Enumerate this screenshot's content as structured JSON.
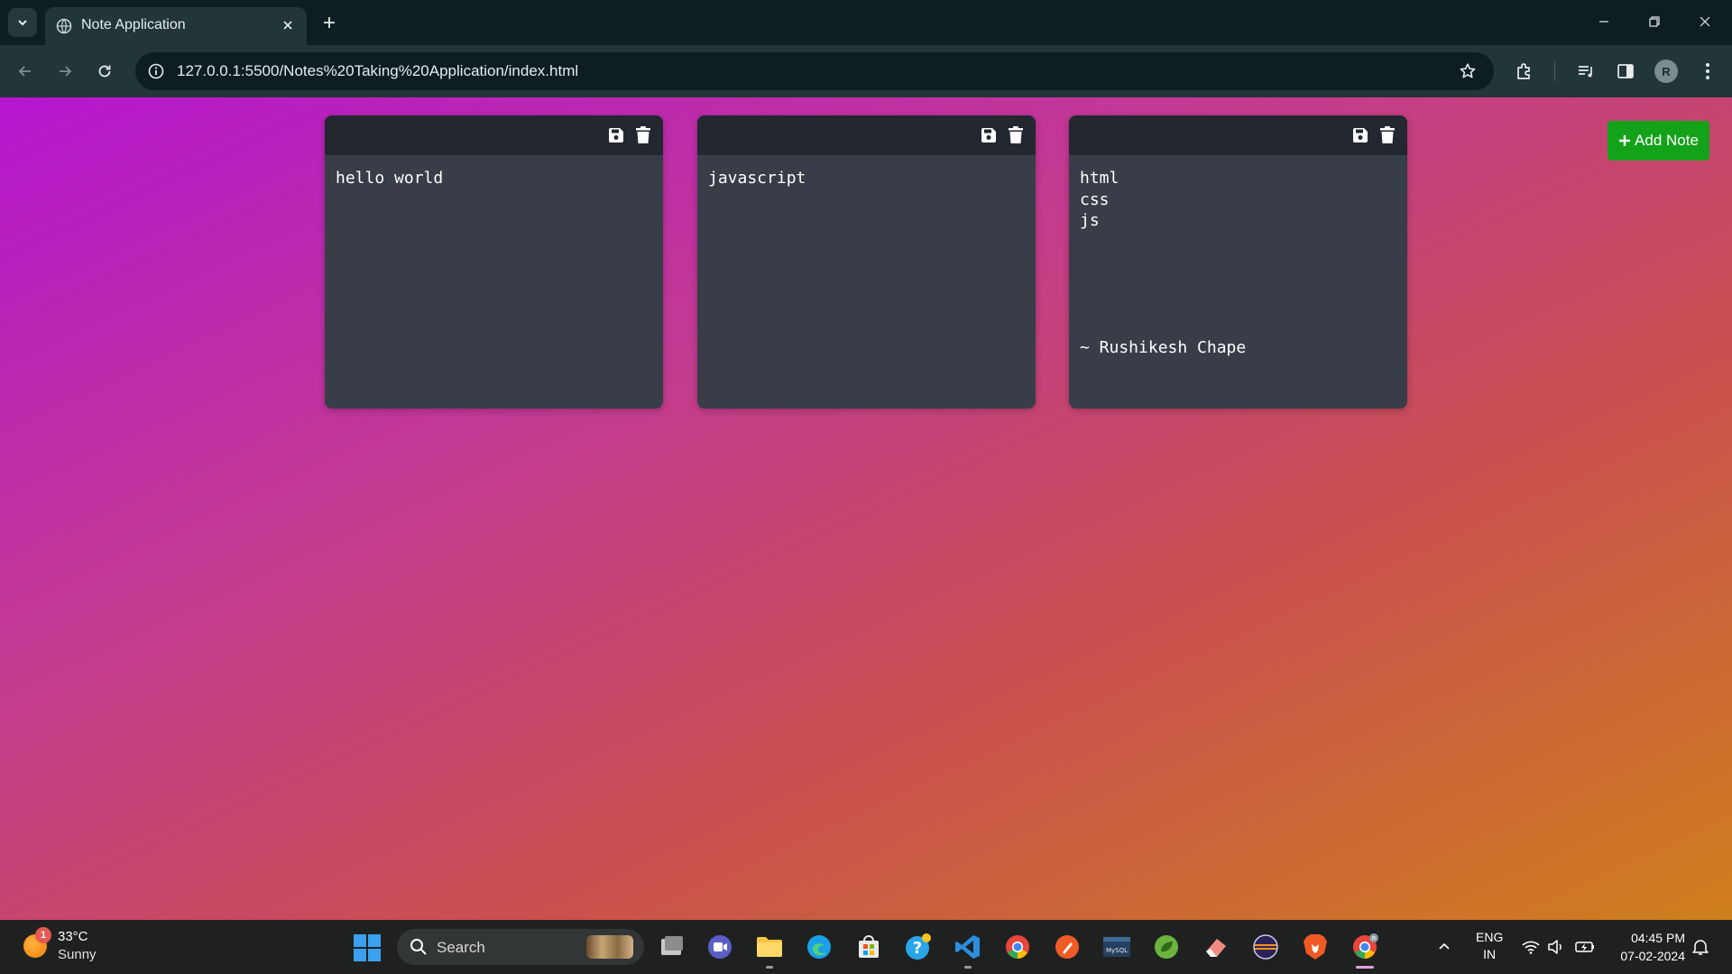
{
  "browser": {
    "tab_title": "Note Application",
    "url": "127.0.0.1:5500/Notes%20Taking%20Application/index.html",
    "profile_initial": "R"
  },
  "page": {
    "add_button_label": "Add Note",
    "notes": [
      {
        "text": "hello world"
      },
      {
        "text": "javascript"
      },
      {
        "text": "html\ncss\njs\n\n\n\n\n\n~ Rushikesh Chape"
      }
    ]
  },
  "taskbar": {
    "weather": {
      "temp": "33°C",
      "condition": "Sunny",
      "badge": "1"
    },
    "search_label": "Search",
    "lang_line1": "ENG",
    "lang_line2": "IN",
    "time": "04:45 PM",
    "date": "07-02-2024",
    "chrome_badge": "R"
  },
  "colors": {
    "add_button": "#14a21a",
    "note_body": "#383d47",
    "note_header": "#222730",
    "page_gradient_start": "#b416cf",
    "page_gradient_end": "#cf7f1c"
  }
}
